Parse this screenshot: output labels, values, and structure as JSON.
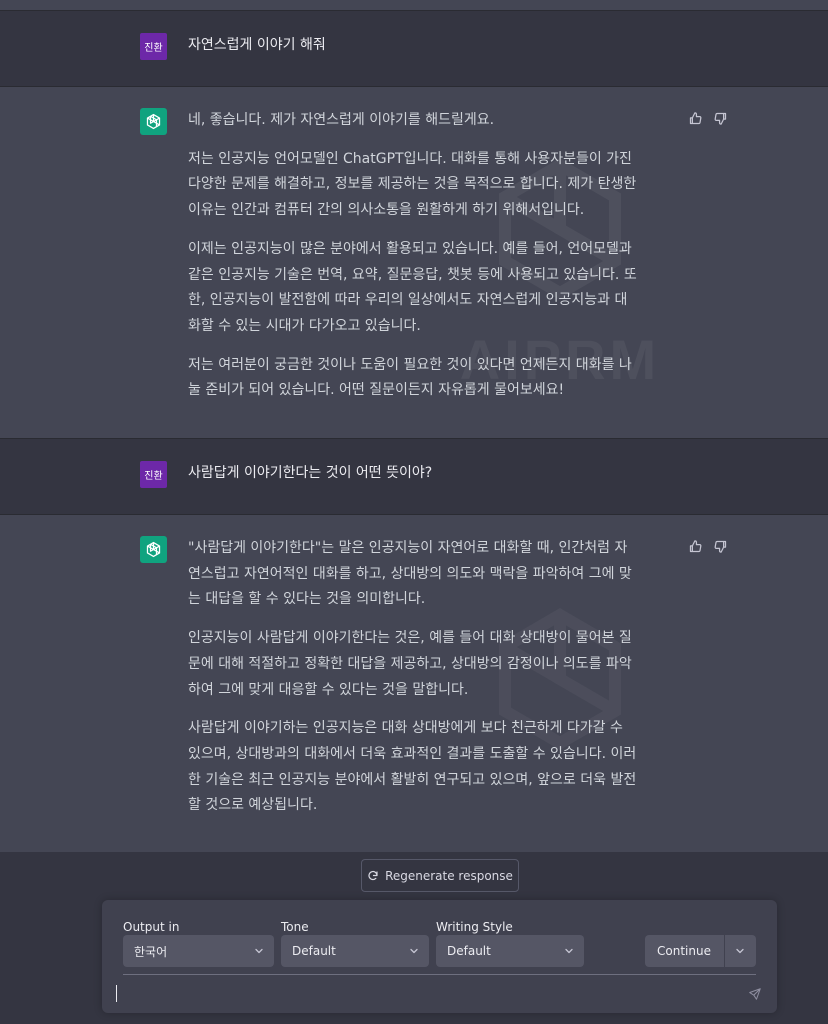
{
  "conversation": {
    "turn1": {
      "user_avatar": "진환",
      "user_text": "자연스럽게 이야기 해줘",
      "assistant_paragraphs": [
        "네, 좋습니다. 제가 자연스럽게 이야기를 해드릴게요.",
        "저는 인공지능 언어모델인 ChatGPT입니다. 대화를 통해 사용자분들이 가진\n다양한 문제를 해결하고, 정보를 제공하는 것을 목적으로 합니다. 제가 탄생한\n이유는 인간과 컴퓨터 간의 의사소통을 원활하게 하기 위해서입니다.",
        "이제는 인공지능이 많은 분야에서 활용되고 있습니다. 예를 들어, 언어모델과\n같은 인공지능 기술은 번역, 요약, 질문응답, 챗봇 등에 사용되고 있습니다. 또\n한, 인공지능이 발전함에 따라 우리의 일상에서도 자연스럽게 인공지능과 대\n화할 수 있는 시대가 다가오고 있습니다.",
        "저는 여러분이 궁금한 것이나 도움이 필요한 것이 있다면 언제든지 대화를 나\n눌 준비가 되어 있습니다. 어떤 질문이든지 자유롭게 물어보세요!"
      ]
    },
    "turn2": {
      "user_avatar": "진환",
      "user_text": "사람답게 이야기한다는 것이 어떤 뜻이야?",
      "assistant_paragraphs": [
        "\"사람답게 이야기한다\"는 말은 인공지능이 자연어로 대화할 때, 인간처럼 자\n연스럽고 자연어적인 대화를 하고, 상대방의 의도와 맥락을 파악하여 그에 맞\n는 대답을 할 수 있다는 것을 의미합니다.",
        "인공지능이 사람답게 이야기한다는 것은, 예를 들어 대화 상대방이 물어본 질\n문에 대해 적절하고 정확한 대답을 제공하고, 상대방의 감정이나 의도를 파악\n하여 그에 맞게 대응할 수 있다는 것을 말합니다.",
        "사람답게 이야기하는 인공지능은 대화 상대방에게 보다 친근하게 다가갈 수\n있으며, 상대방과의 대화에서 더욱 효과적인 결과를 도출할 수 있습니다. 이러\n한 기술은 최근 인공지능 분야에서 활발히 연구되고 있으며, 앞으로 더욱 발전\n할 것으로 예상됩니다."
      ]
    }
  },
  "watermark_text": "AIPRM",
  "regenerate_label": "Regenerate response",
  "controls": {
    "output_label": "Output in",
    "output_value": "한국어",
    "tone_label": "Tone",
    "tone_value": "Default",
    "style_label": "Writing Style",
    "style_value": "Default",
    "continue_label": "Continue"
  },
  "icons": {
    "assistant": "openai-logo-icon",
    "like": "thumbs-up-icon",
    "dislike": "thumbs-down-icon",
    "regenerate": "refresh-icon",
    "send": "send-icon",
    "dropdown": "chevron-down-icon"
  },
  "colors": {
    "background": "#343541",
    "assistant_row": "#444654",
    "user_avatar": "#6d28a8",
    "assistant_avatar": "#10a37f"
  }
}
